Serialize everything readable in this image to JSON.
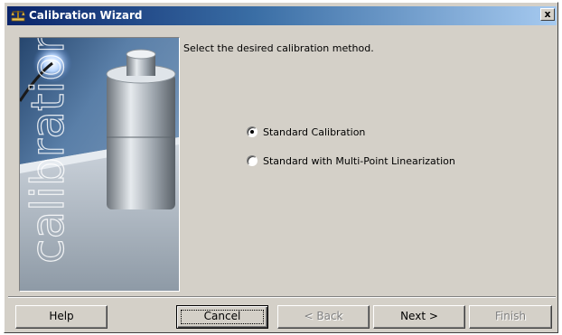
{
  "window": {
    "title": "Calibration Wizard",
    "close_label": "x"
  },
  "side_image": {
    "watermark_text": "calibration"
  },
  "instruction": "Select the desired calibration method.",
  "options": [
    {
      "label": "Standard Calibration",
      "selected": true
    },
    {
      "label": "Standard with Multi-Point Linearization",
      "selected": false
    }
  ],
  "buttons": {
    "help": "Help",
    "cancel": "Cancel",
    "back": "< Back",
    "next": "Next >",
    "finish": "Finish"
  },
  "colors": {
    "titlebar_start": "#0a246a",
    "titlebar_end": "#a6caf0",
    "dialog_bg": "#d4d0c8"
  }
}
